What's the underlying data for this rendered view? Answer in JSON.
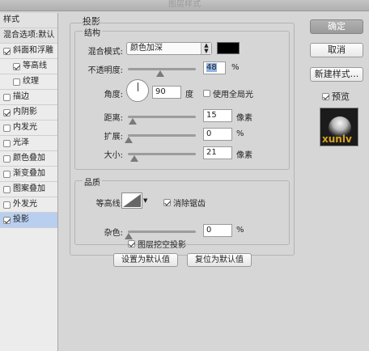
{
  "window": {
    "title": "图层样式"
  },
  "sidebar": {
    "items": [
      {
        "label": "样式",
        "checked": null
      },
      {
        "label": "混合选项:默认",
        "checked": null
      },
      {
        "label": "斜面和浮雕",
        "checked": true
      },
      {
        "label": "等高线",
        "checked": true
      },
      {
        "label": "纹理",
        "checked": false
      },
      {
        "label": "描边",
        "checked": false
      },
      {
        "label": "内阴影",
        "checked": true
      },
      {
        "label": "内发光",
        "checked": false
      },
      {
        "label": "光泽",
        "checked": false
      },
      {
        "label": "颜色叠加",
        "checked": false
      },
      {
        "label": "渐变叠加",
        "checked": false
      },
      {
        "label": "图案叠加",
        "checked": false
      },
      {
        "label": "外发光",
        "checked": false
      },
      {
        "label": "投影",
        "checked": true
      }
    ]
  },
  "panel": {
    "title": "投影",
    "structure": {
      "title": "结构",
      "blend_mode_label": "混合模式:",
      "blend_mode_value": "颜色加深",
      "shadow_color": "#000000",
      "opacity_label": "不透明度:",
      "opacity_value": "48",
      "opacity_fraction": 0.48,
      "percent": "%",
      "angle_label": "角度:",
      "angle_value": "90",
      "angle_unit": "度",
      "global_light_label": "使用全局光",
      "global_light_checked": false,
      "distance_label": "距离:",
      "distance_value": "15",
      "px_unit": "像素",
      "spread_label": "扩展:",
      "spread_value": "0",
      "size_label": "大小:",
      "size_value": "21"
    },
    "quality": {
      "title": "品质",
      "contour_label": "等高线:",
      "antialias_label": "消除锯齿",
      "antialias_checked": true,
      "noise_label": "杂色:",
      "noise_value": "0"
    },
    "knockout_label": "图层挖空投影",
    "knockout_checked": true,
    "make_default_label": "设置为默认值",
    "reset_default_label": "复位为默认值"
  },
  "actions": {
    "ok_label": "确定",
    "cancel_label": "取消",
    "new_style_label": "新建样式...",
    "preview_label": "预览",
    "preview_checked": true
  },
  "watermark": "xunlv"
}
